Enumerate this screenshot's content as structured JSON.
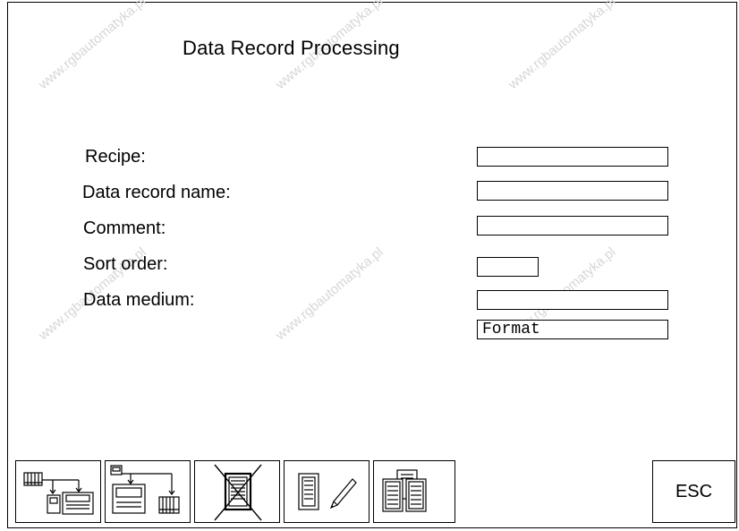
{
  "screen": {
    "title": "Data Record Processing"
  },
  "form": {
    "recipe_label": "Recipe:",
    "data_record_name_label": "Data record name:",
    "comment_label": "Comment:",
    "sort_order_label": "Sort order:",
    "data_medium_label": "Data medium:",
    "recipe_value": "",
    "data_record_name_value": "",
    "comment_value": "",
    "sort_order_value": "",
    "data_medium_value": "",
    "format_value": "Format"
  },
  "softkeys": {
    "key1_icon": "plc-to-terminal-transfer-icon",
    "key2_icon": "terminal-to-plc-transfer-icon",
    "key3_icon": "delete-record-icon",
    "key4_icon": "edit-record-icon",
    "key5_icon": "copy-record-icon",
    "esc_label": "ESC"
  },
  "watermark": {
    "text": "www.rgbautomatyka.pl"
  }
}
